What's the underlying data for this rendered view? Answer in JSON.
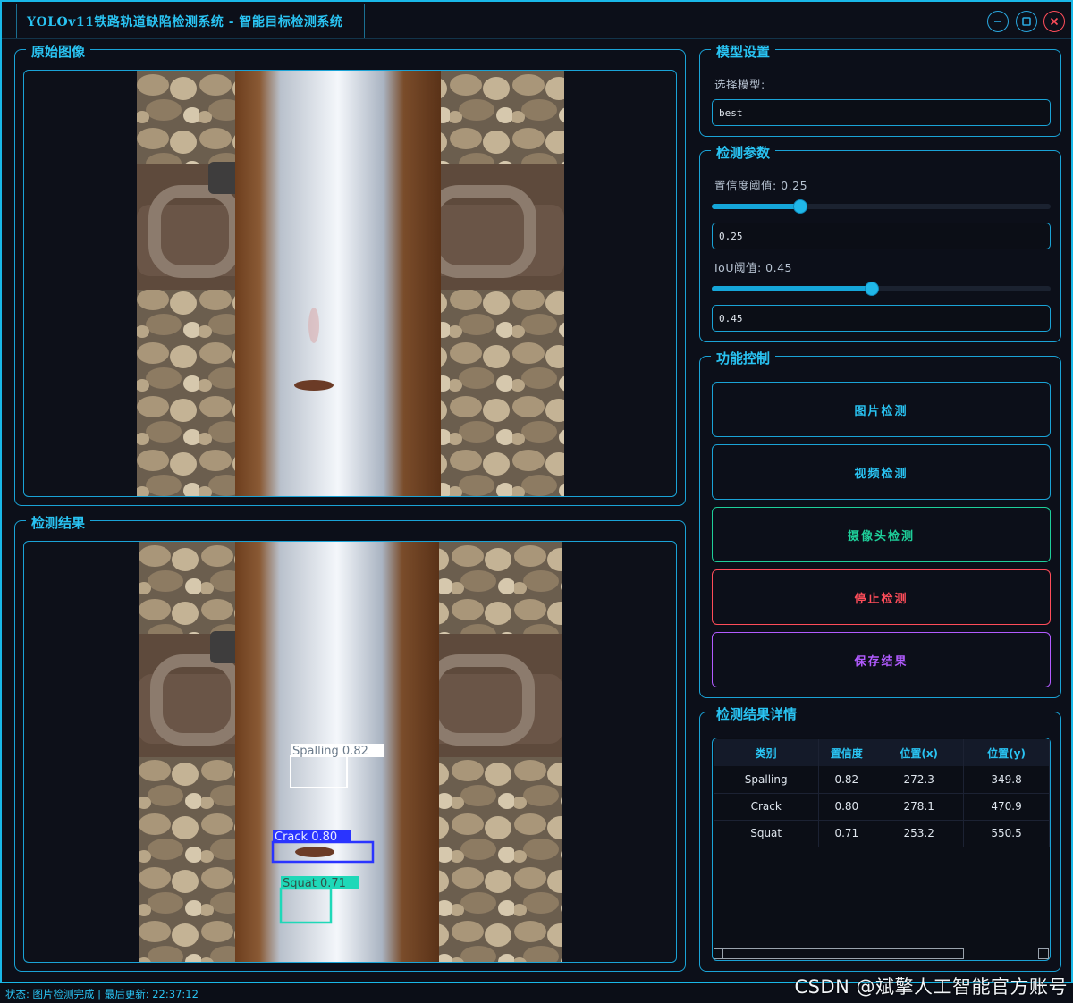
{
  "window": {
    "title": "YOLOv11铁路轨道缺陷检测系统 - 智能目标检测系统"
  },
  "panels": {
    "original_title": "原始图像",
    "result_title": "检测结果",
    "model_title": "模型设置",
    "params_title": "检测参数",
    "control_title": "功能控制",
    "details_title": "检测结果详情"
  },
  "model": {
    "select_label": "选择模型:",
    "selected": "best"
  },
  "params": {
    "conf_label": "置信度阈值: 0.25",
    "conf_value": "0.25",
    "conf_level": 0.25,
    "iou_label": "IoU阈值: 0.45",
    "iou_value": "0.45",
    "iou_level": 0.45
  },
  "buttons": {
    "image_detect": "图片检测",
    "video_detect": "视频检测",
    "camera_detect": "摄像头检测",
    "stop_detect": "停止检测",
    "save_results": "保存结果"
  },
  "detections": [
    {
      "label": "Spalling 0.82",
      "color": "#ffffff"
    },
    {
      "label": "Crack 0.80",
      "color": "#2a34ff"
    },
    {
      "label": "Squat 0.71",
      "color": "#1fd8b8"
    }
  ],
  "table": {
    "headers": [
      "类别",
      "置信度",
      "位置(x)",
      "位置(y)"
    ],
    "rows": [
      [
        "Spalling",
        "0.82",
        "272.3",
        "349.8"
      ],
      [
        "Crack",
        "0.80",
        "278.1",
        "470.9"
      ],
      [
        "Squat",
        "0.71",
        "253.2",
        "550.5"
      ]
    ]
  },
  "status": "状态: 图片检测完成 | 最后更新: 22:37:12",
  "watermark": "CSDN @斌擎人工智能官方账号",
  "colors": {
    "accent": "#29c3f2",
    "border": "#1aa3d6",
    "camera_btn": "#1ecf9a",
    "stop_btn": "#ff4d5a",
    "save_btn": "#b25bff"
  }
}
